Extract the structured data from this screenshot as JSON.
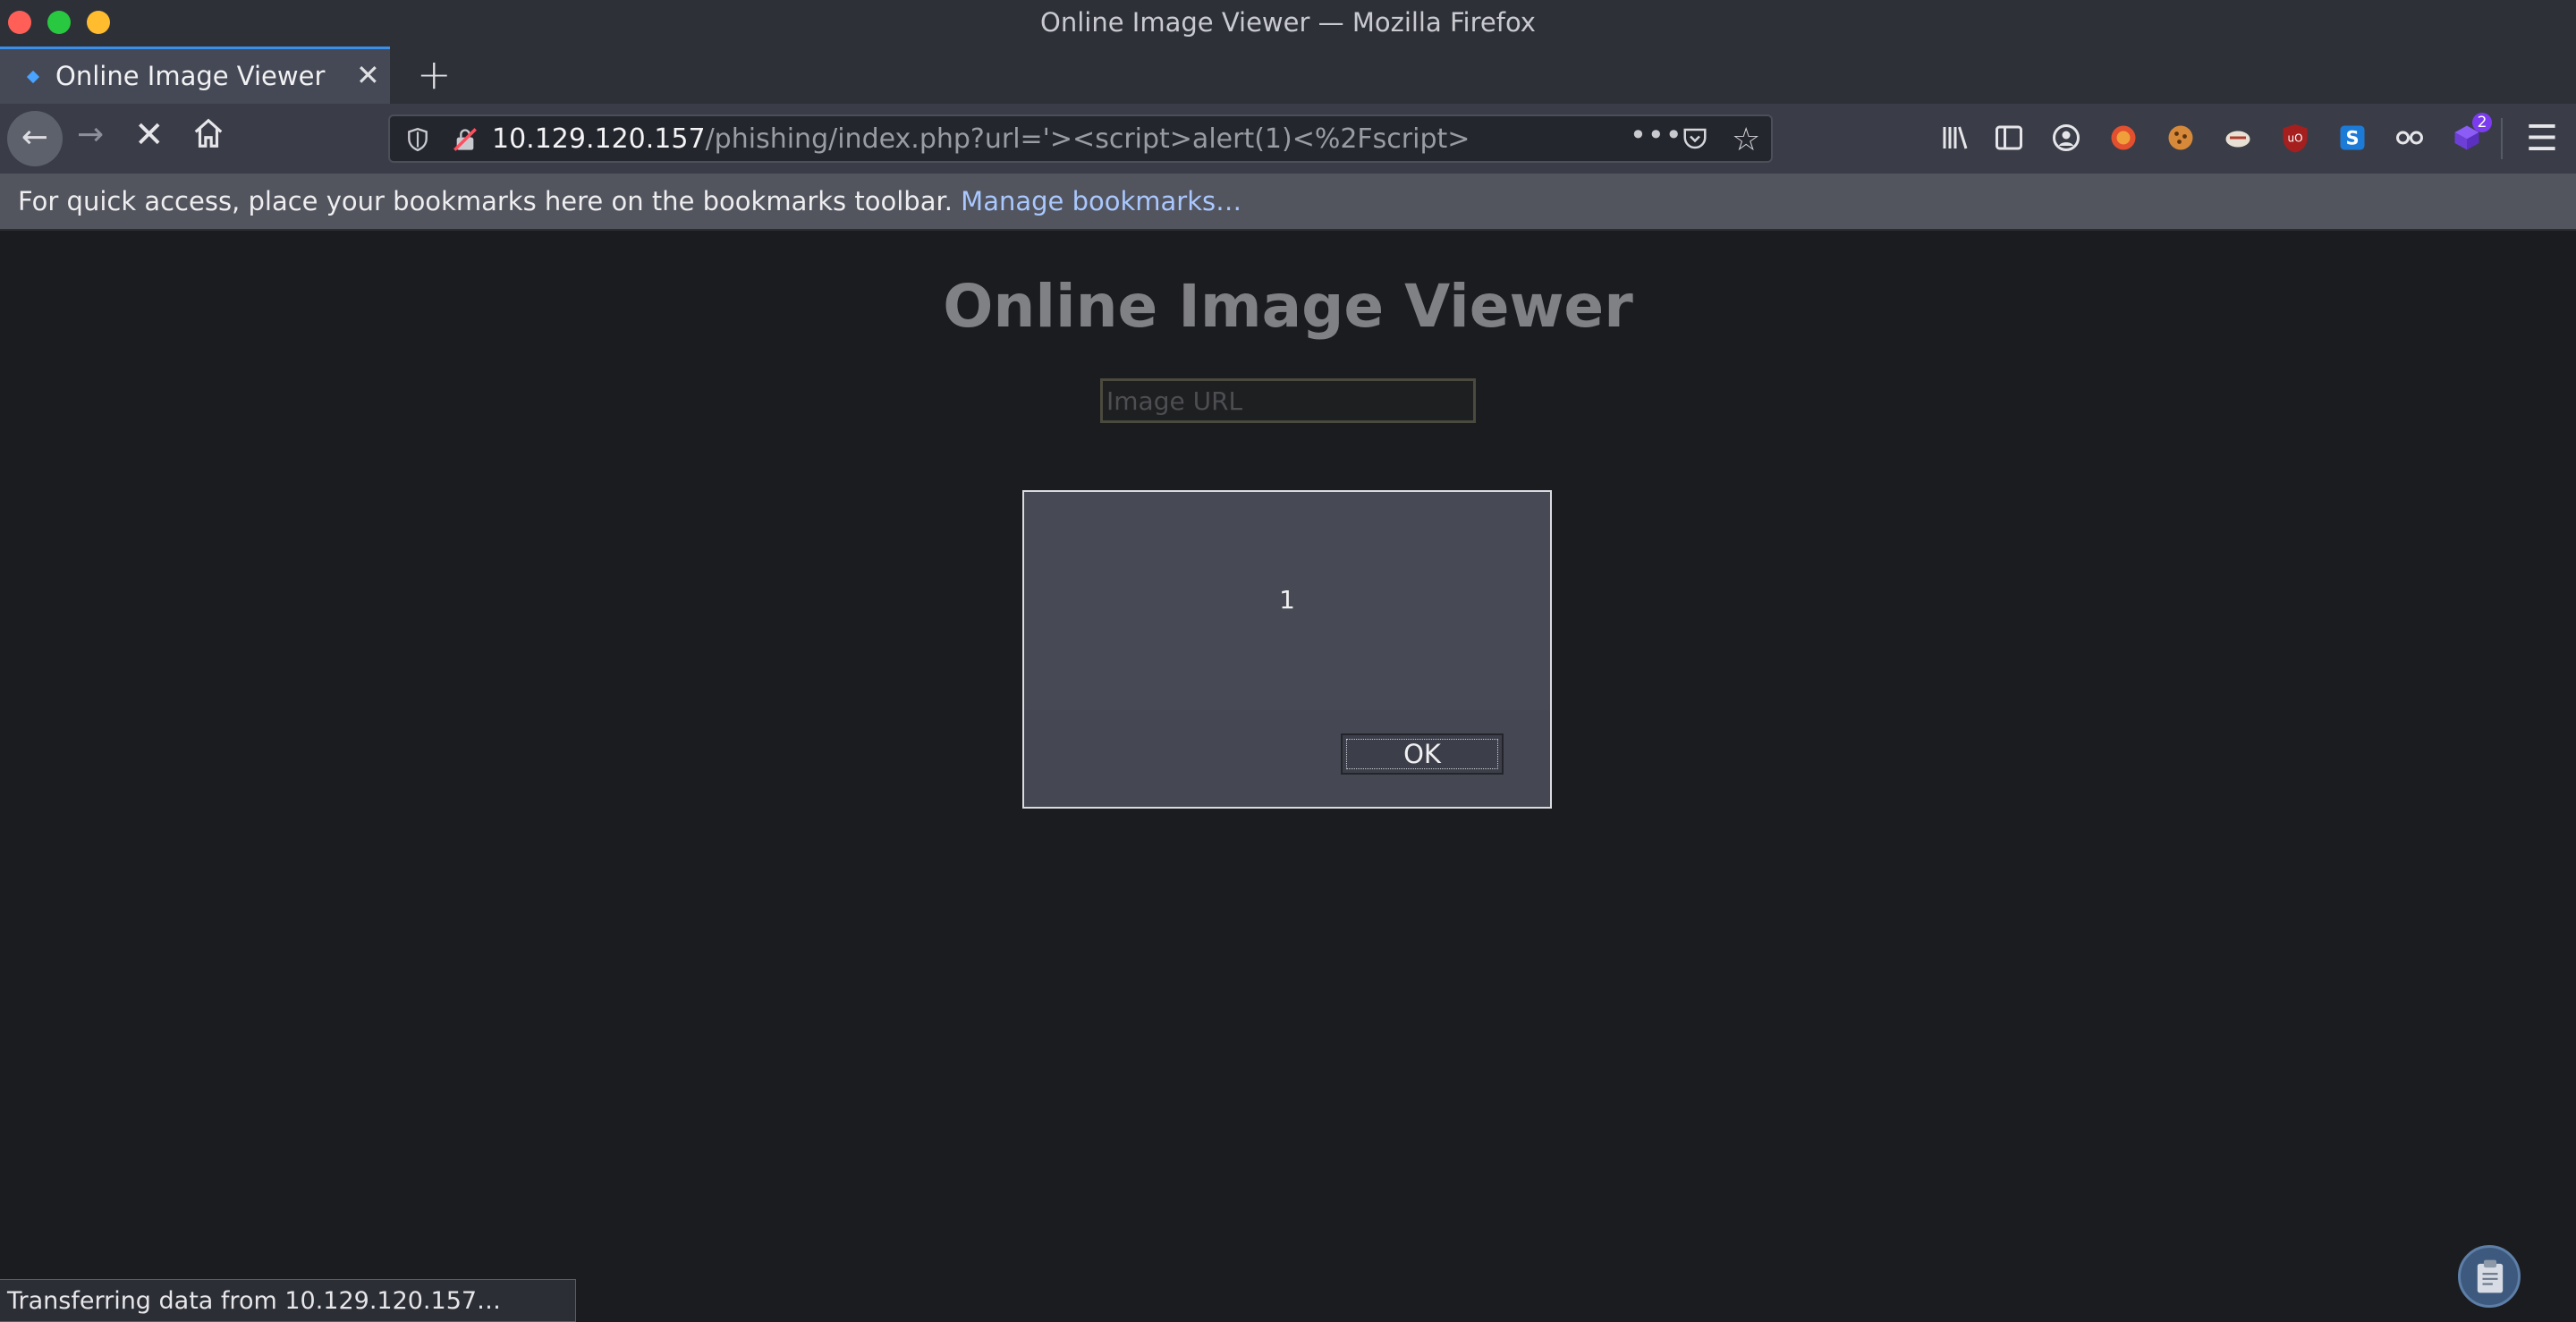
{
  "window": {
    "title": "Online Image Viewer — Mozilla Firefox"
  },
  "tab": {
    "title": "Online Image Viewer",
    "close_glyph": "✕",
    "new_tab_glyph": "+"
  },
  "nav": {
    "back_glyph": "←",
    "forward_glyph": "→",
    "stop_glyph": "✕",
    "url_host": "10.129.120.157",
    "url_path": "/phishing/index.php?url='><script>alert(1)<%2Fscript>",
    "page_actions_glyph": "•••",
    "star_glyph": "☆",
    "menu_glyph": "☰",
    "extension_badge": "2"
  },
  "bookmarks_bar": {
    "text": "For quick access, place your bookmarks here on the bookmarks toolbar. ",
    "link": "Manage bookmarks…"
  },
  "page": {
    "title": "Online Image Viewer",
    "input_placeholder": "Image URL",
    "input_value": ""
  },
  "alert": {
    "message": "1",
    "ok_label": "OK"
  },
  "status": {
    "text": "Transferring data from 10.129.120.157…"
  },
  "colors": {
    "accent_tab": "#3b8fe8",
    "link": "#a9c8ff",
    "page_bg": "#1b1c1f",
    "badge": "#7b3cf0"
  }
}
